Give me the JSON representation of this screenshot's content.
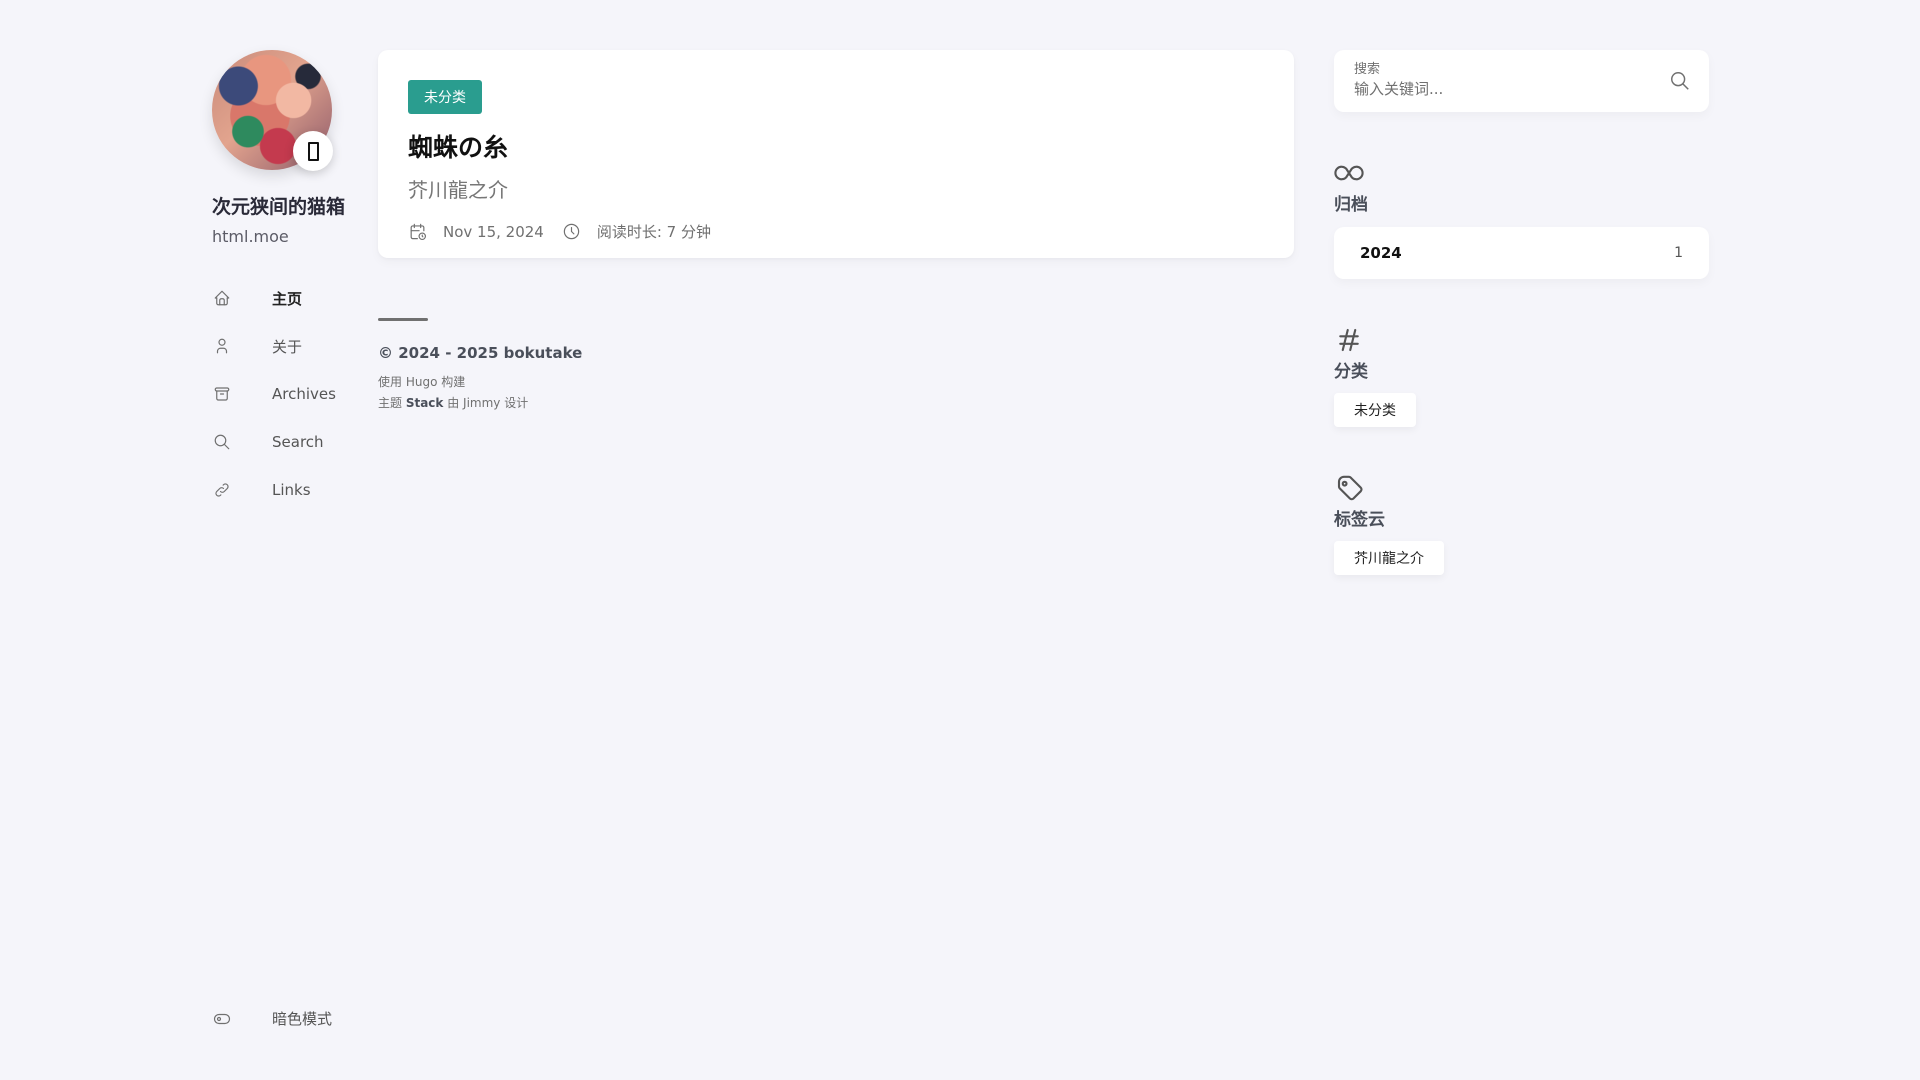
{
  "site": {
    "name": "次元狭间的猫箱",
    "description": "html.moe"
  },
  "menu": [
    {
      "label": "主页",
      "icon": "home-icon",
      "active": true
    },
    {
      "label": "关于",
      "icon": "user-icon"
    },
    {
      "label": "Archives",
      "icon": "archive-icon"
    },
    {
      "label": "Search",
      "icon": "search-icon"
    },
    {
      "label": "Links",
      "icon": "link-icon"
    }
  ],
  "dark_mode": {
    "label": "暗色模式",
    "icon": "toggle-icon"
  },
  "post": {
    "category": "未分类",
    "title": "蜘蛛の糸",
    "subtitle": "芥川龍之介",
    "date": "Nov 15, 2024",
    "reading_time": "阅读时长: 7 分钟",
    "accent_color": "#2a9d8f"
  },
  "footer": {
    "copyright": "© 2024 - 2025 bokutake",
    "powered_prefix": "使用 ",
    "powered_name": "Hugo",
    "powered_suffix": " 构建",
    "theme_prefix": "主题 ",
    "theme_name": "Stack",
    "theme_middle": " 由 ",
    "theme_author": "Jimmy",
    "theme_suffix": " 设计"
  },
  "search": {
    "label": "搜索",
    "placeholder": "输入关键词..."
  },
  "widgets": {
    "archives": {
      "title": "归档",
      "icon": "infinity-icon",
      "items": [
        {
          "year": "2024",
          "count": "1"
        }
      ]
    },
    "categories": {
      "title": "分类",
      "icon": "hash-icon",
      "items": [
        "未分类"
      ]
    },
    "tags": {
      "title": "标签云",
      "icon": "tag-icon",
      "items": [
        "芥川龍之介"
      ]
    }
  }
}
